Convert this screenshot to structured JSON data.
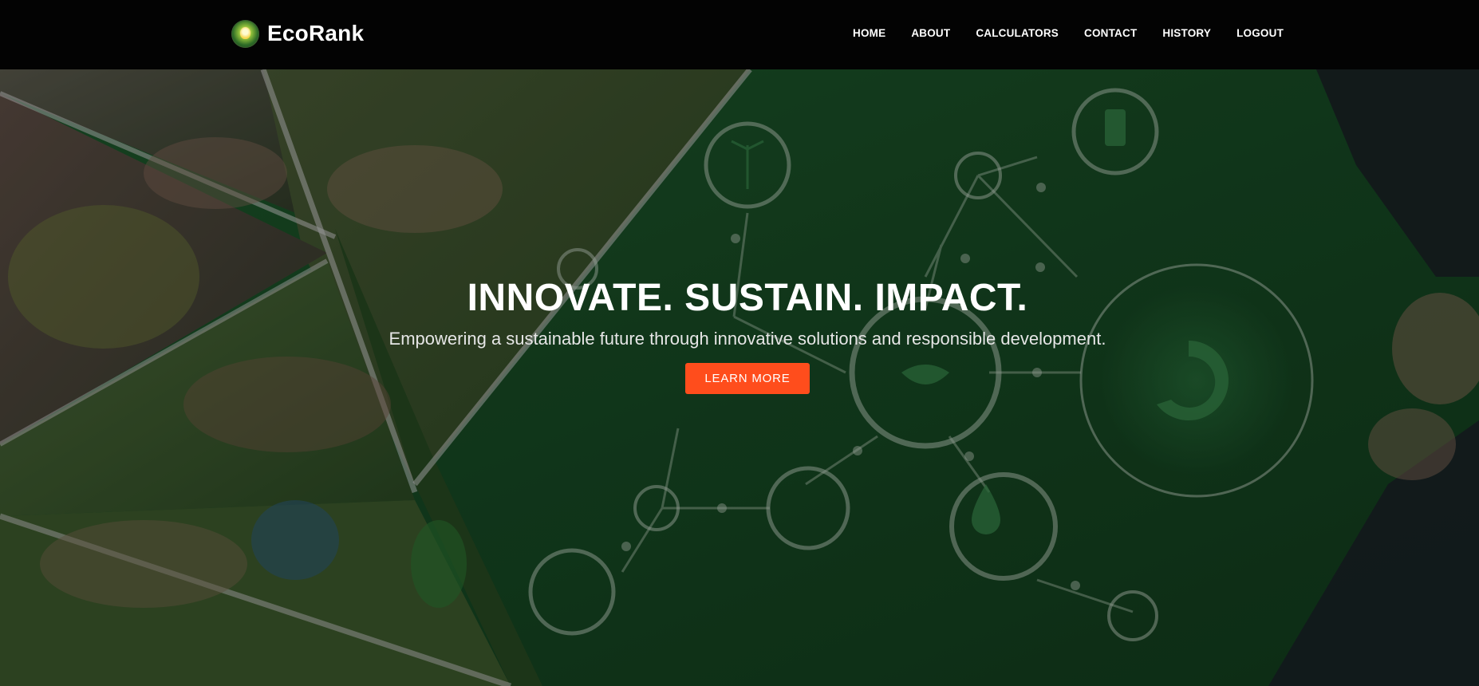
{
  "brand": {
    "name": "EcoRank",
    "logo_icon": "eco-bulb-logo-icon"
  },
  "nav": {
    "items": [
      {
        "label": "HOME"
      },
      {
        "label": "ABOUT"
      },
      {
        "label": "CALCULATORS"
      },
      {
        "label": "CONTACT"
      },
      {
        "label": "HISTORY"
      },
      {
        "label": "LOGOUT"
      }
    ]
  },
  "hero": {
    "title": "INNOVATE. SUSTAIN. IMPACT.",
    "subtitle": "Empowering a sustainable future through innovative solutions and responsible development.",
    "cta_label": "LEARN MORE",
    "icons": [
      "wind-turbine-icon",
      "battery-leaf-icon",
      "water-drop-icon",
      "house-icon",
      "hands-leaf-icon",
      "recycle-icon",
      "seedling-icon",
      "droplet-icon",
      "cloud-icon",
      "sun-icon"
    ]
  },
  "colors": {
    "navbar_bg": "#030303",
    "cta_bg": "#ff4d1c",
    "hero_green": "#0d2a16"
  }
}
